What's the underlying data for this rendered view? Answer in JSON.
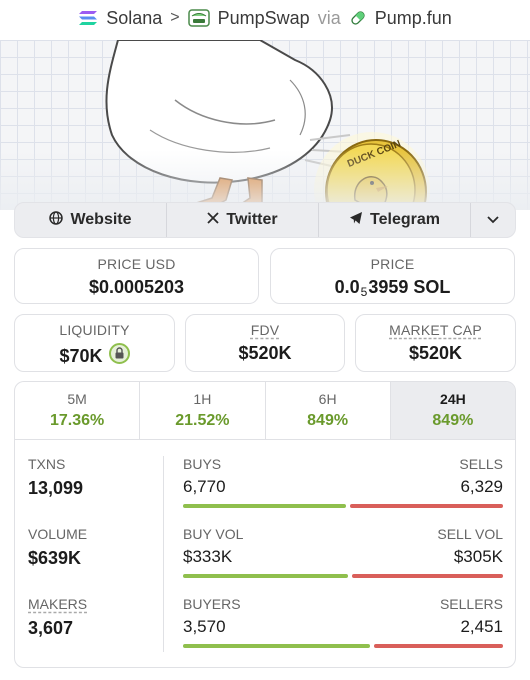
{
  "breadcrumb": {
    "chain": "Solana",
    "dex": "PumpSwap",
    "via": "via",
    "launchpad": "Pump.fun"
  },
  "links": {
    "website": "Website",
    "twitter": "Twitter",
    "telegram": "Telegram"
  },
  "price": {
    "usd_label": "PRICE USD",
    "usd_value": "$0.0005203",
    "native_label": "PRICE",
    "native_prefix": "0.0",
    "native_zeros": "5",
    "native_digits": "3959",
    "native_unit": "SOL"
  },
  "metrics": {
    "liquidity_label": "LIQUIDITY",
    "liquidity_value": "$70K",
    "fdv_label": "FDV",
    "fdv_value": "$520K",
    "mcap_label": "MARKET CAP",
    "mcap_value": "$520K"
  },
  "timeframes": [
    {
      "label": "5M",
      "change": "17.36%"
    },
    {
      "label": "1H",
      "change": "21.52%"
    },
    {
      "label": "6H",
      "change": "849%"
    },
    {
      "label": "24H",
      "change": "849%"
    }
  ],
  "active_timeframe": "24H",
  "stats": {
    "txns_label": "TXNS",
    "txns_value": "13,099",
    "volume_label": "VOLUME",
    "volume_value": "$639K",
    "makers_label": "MAKERS",
    "makers_value": "3,607",
    "buys_label": "BUYS",
    "buys_value": "6,770",
    "sells_label": "SELLS",
    "sells_value": "6,329",
    "buyvol_label": "BUY VOL",
    "buyvol_value": "$333K",
    "sellvol_label": "SELL VOL",
    "sellvol_value": "$305K",
    "buyers_label": "BUYERS",
    "buyers_value": "3,570",
    "sellers_label": "SELLERS",
    "sellers_value": "2,451"
  },
  "ratios": {
    "buys": 0.517,
    "buy_volume": 0.522,
    "buyers": 0.593
  },
  "banner": {
    "coin_text": "DUCK COIN"
  },
  "colors": {
    "positive": "#6a9a2c",
    "buy_bar": "#8fbf4d",
    "sell_bar": "#d95f5a",
    "coin": "#f0d54c"
  }
}
